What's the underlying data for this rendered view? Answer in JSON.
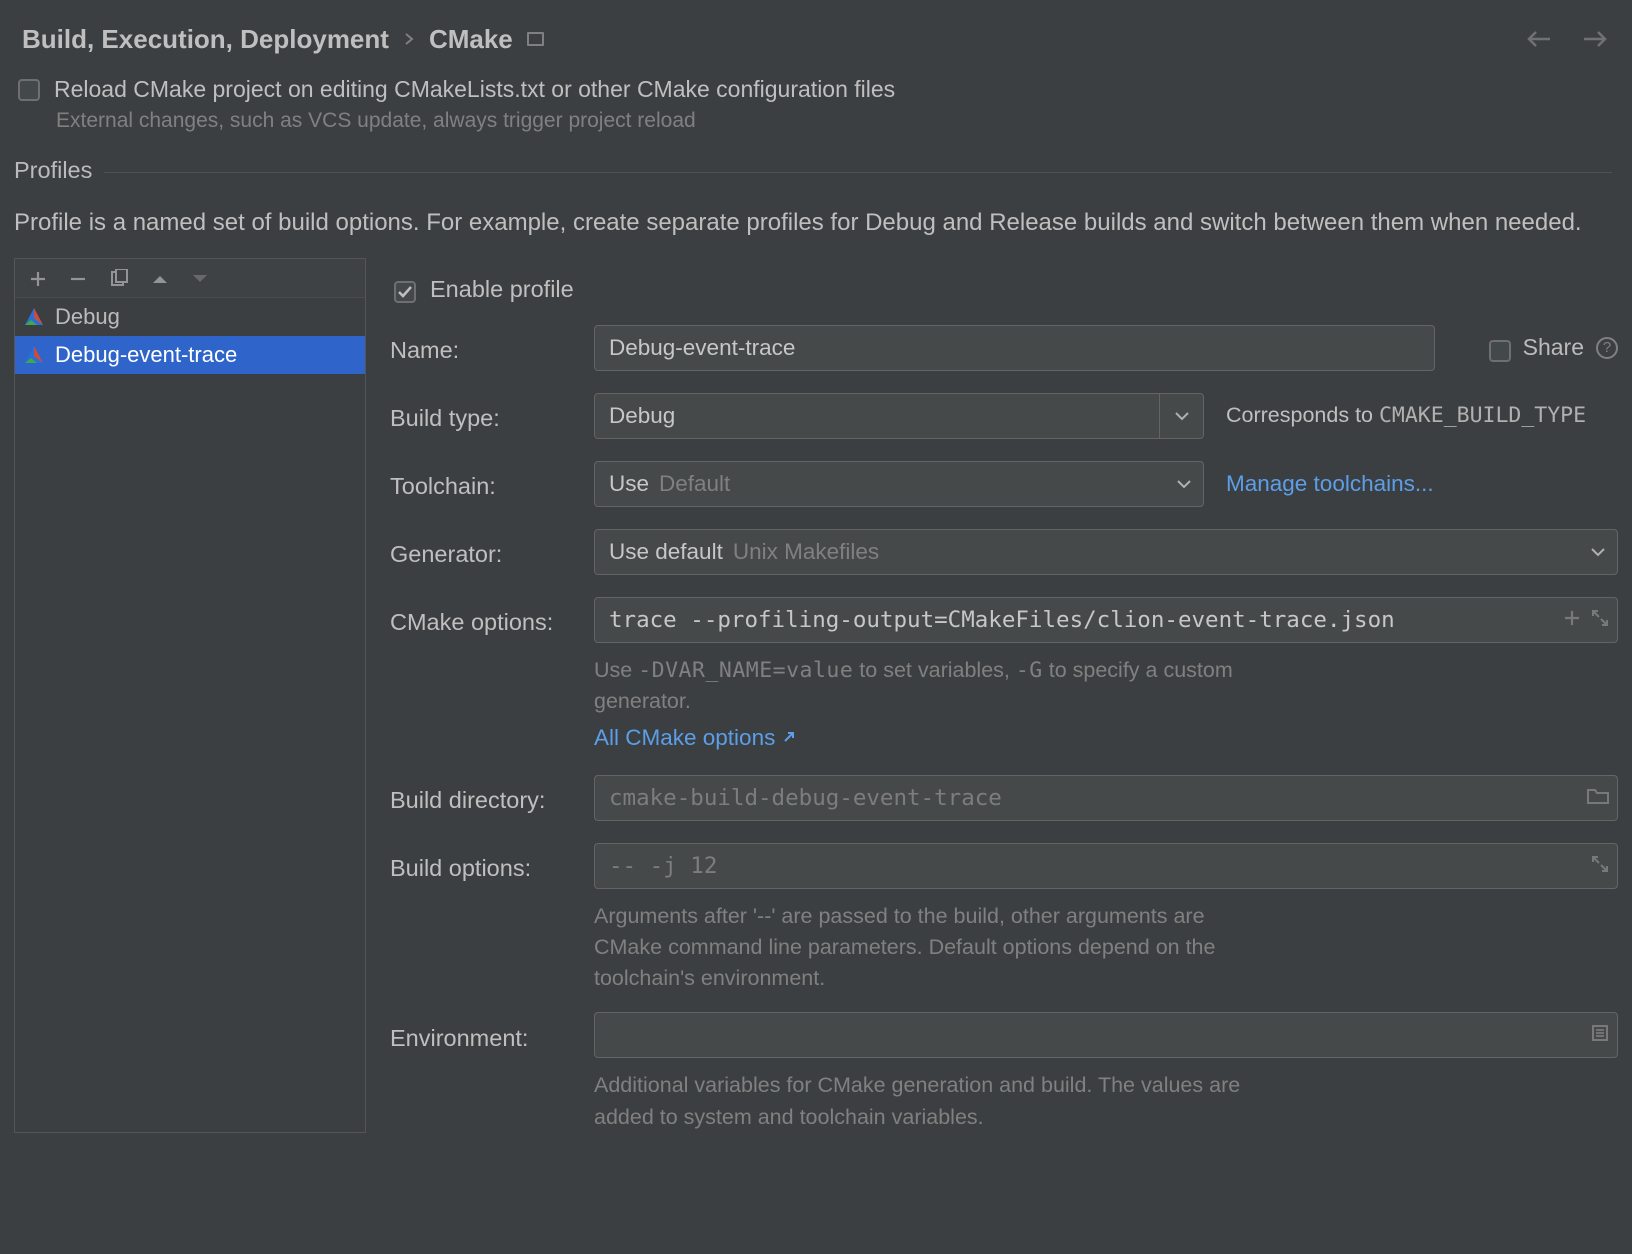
{
  "breadcrumb": {
    "parent": "Build, Execution, Deployment",
    "leaf": "CMake"
  },
  "reload": {
    "label": "Reload CMake project on editing CMakeLists.txt or other CMake configuration files",
    "hint": "External changes, such as VCS update, always trigger project reload",
    "checked": false
  },
  "profiles_section": {
    "title": "Profiles",
    "description": "Profile is a named set of build options. For example, create separate profiles for Debug and Release builds and switch between them when needed."
  },
  "profile_list": [
    {
      "name": "Debug",
      "selected": false
    },
    {
      "name": "Debug-event-trace",
      "selected": true
    }
  ],
  "enable_profile": {
    "label": "Enable profile",
    "checked": true
  },
  "share": {
    "label": "Share",
    "checked": false
  },
  "fields": {
    "name": {
      "label": "Name:",
      "value": "Debug-event-trace"
    },
    "build_type": {
      "label": "Build type:",
      "value": "Debug",
      "note_prefix": "Corresponds to ",
      "note_code": "CMAKE_BUILD_TYPE"
    },
    "toolchain": {
      "label": "Toolchain:",
      "prefix": "Use",
      "value": "Default",
      "manage_link": "Manage toolchains..."
    },
    "generator": {
      "label": "Generator:",
      "prefix": "Use default",
      "value": "Unix Makefiles"
    },
    "cmake_options": {
      "label": "CMake options:",
      "value": "trace --profiling-output=CMakeFiles/clion-event-trace.json",
      "hint1_a": "Use ",
      "hint1_code1": "-DVAR_NAME=value",
      "hint1_b": " to set variables, ",
      "hint1_code2": "-G",
      "hint1_c": " to specify a custom generator.",
      "all_link": "All CMake options"
    },
    "build_dir": {
      "label": "Build directory:",
      "placeholder": "cmake-build-debug-event-trace"
    },
    "build_options": {
      "label": "Build options:",
      "placeholder": "-- -j 12",
      "hint": "Arguments after '--' are passed to the build, other arguments are CMake command line parameters. Default options depend on the toolchain's environment."
    },
    "environment": {
      "label": "Environment:",
      "value": "",
      "hint": "Additional variables for CMake generation and build. The values are added to system and toolchain variables."
    }
  }
}
